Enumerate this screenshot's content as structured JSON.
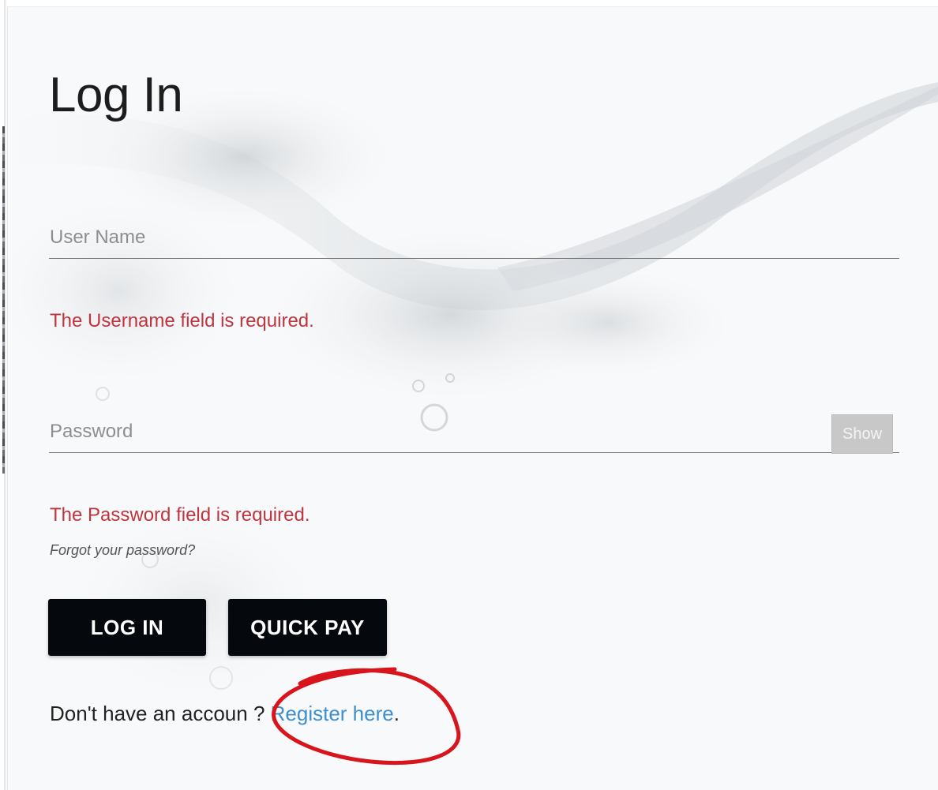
{
  "login": {
    "title": "Log In",
    "username": {
      "placeholder": "User Name",
      "value": "",
      "error": "The Username field is required."
    },
    "password": {
      "placeholder": "Password",
      "value": "",
      "show_label": "Show",
      "error": "The Password field is required."
    },
    "forgot_link": "Forgot your password?",
    "login_button": "LOG IN",
    "quickpay_button": "QUICK PAY",
    "register_prompt": "Don't have an accoun",
    "register_prompt_tail": "?",
    "register_link": "Register here",
    "register_end": "."
  },
  "annotation": {
    "color": "#d8141c",
    "shape": "hand-drawn-circle"
  },
  "colors": {
    "error": "#c0343e",
    "link": "#3f8fce",
    "button_bg": "#05080c",
    "show_button_bg": "#c8c8c8"
  }
}
